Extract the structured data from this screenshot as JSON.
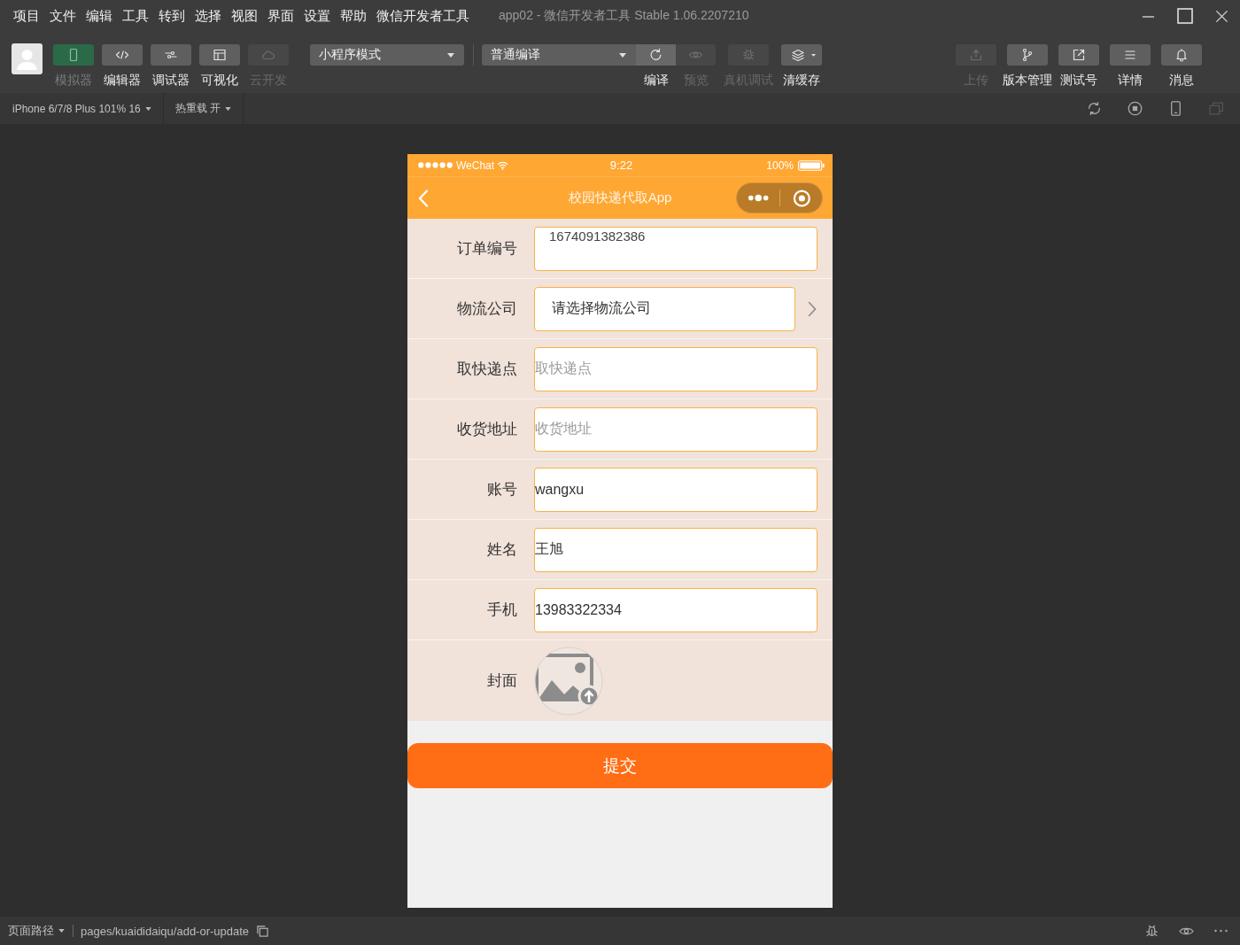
{
  "menu_bar": {
    "items": [
      "项目",
      "文件",
      "编辑",
      "工具",
      "转到",
      "选择",
      "视图",
      "界面",
      "设置",
      "帮助",
      "微信开发者工具"
    ],
    "title": "app02 - 微信开发者工具 Stable 1.06.2207210"
  },
  "toolbar": {
    "view_buttons": [
      {
        "kind": "phone",
        "label": "模拟器",
        "selected": true,
        "disabled": false
      },
      {
        "kind": "code",
        "label": "编辑器",
        "selected": false,
        "disabled": false
      },
      {
        "kind": "sliders",
        "label": "调试器",
        "selected": false,
        "disabled": false
      },
      {
        "kind": "layout",
        "label": "可视化",
        "selected": false,
        "disabled": false
      },
      {
        "kind": "cloud",
        "label": "云开发",
        "selected": false,
        "disabled": true
      }
    ],
    "mode_dropdown": "小程序模式",
    "compile_dropdown": "普通编译",
    "compile_buttons": [
      {
        "kind": "refresh",
        "label": "编译",
        "disabled": false
      },
      {
        "kind": "eye",
        "label": "预览",
        "disabled": true
      },
      {
        "kind": "bug",
        "label": "真机调试",
        "disabled": true
      },
      {
        "kind": "layers",
        "label": "清缓存",
        "disabled": false
      }
    ],
    "right_buttons": [
      {
        "kind": "upload",
        "label": "上传",
        "disabled": true
      },
      {
        "kind": "branch",
        "label": "版本管理",
        "disabled": false
      },
      {
        "kind": "external",
        "label": "测试号",
        "disabled": false
      },
      {
        "kind": "list",
        "label": "详情",
        "disabled": false
      },
      {
        "kind": "bell",
        "label": "消息",
        "disabled": false
      }
    ]
  },
  "sub_toolbar": {
    "device": "iPhone 6/7/8 Plus 101% 16",
    "hot_reload": "热重载 开"
  },
  "phone": {
    "status_bar": {
      "carrier": "WeChat",
      "time": "9:22",
      "battery": "100%"
    },
    "nav_title": "校园快递代取App",
    "form": [
      {
        "kind": "readonly",
        "label": "订单编号",
        "value": "1674091382386"
      },
      {
        "kind": "picker",
        "label": "物流公司",
        "value": "请选择物流公司"
      },
      {
        "kind": "input",
        "label": "取快递点",
        "placeholder": "取快递点"
      },
      {
        "kind": "input",
        "label": "收货地址",
        "placeholder": "收货地址"
      },
      {
        "kind": "input",
        "label": "账号",
        "value": "wangxu"
      },
      {
        "kind": "input",
        "label": "姓名",
        "value": "王旭"
      },
      {
        "kind": "input",
        "label": "手机",
        "value": "13983322334"
      },
      {
        "kind": "upload",
        "label": "封面"
      }
    ],
    "submit": "提交"
  },
  "status_bar": {
    "path_label": "页面路径",
    "path": "pages/kuaididaiqu/add-or-update"
  }
}
